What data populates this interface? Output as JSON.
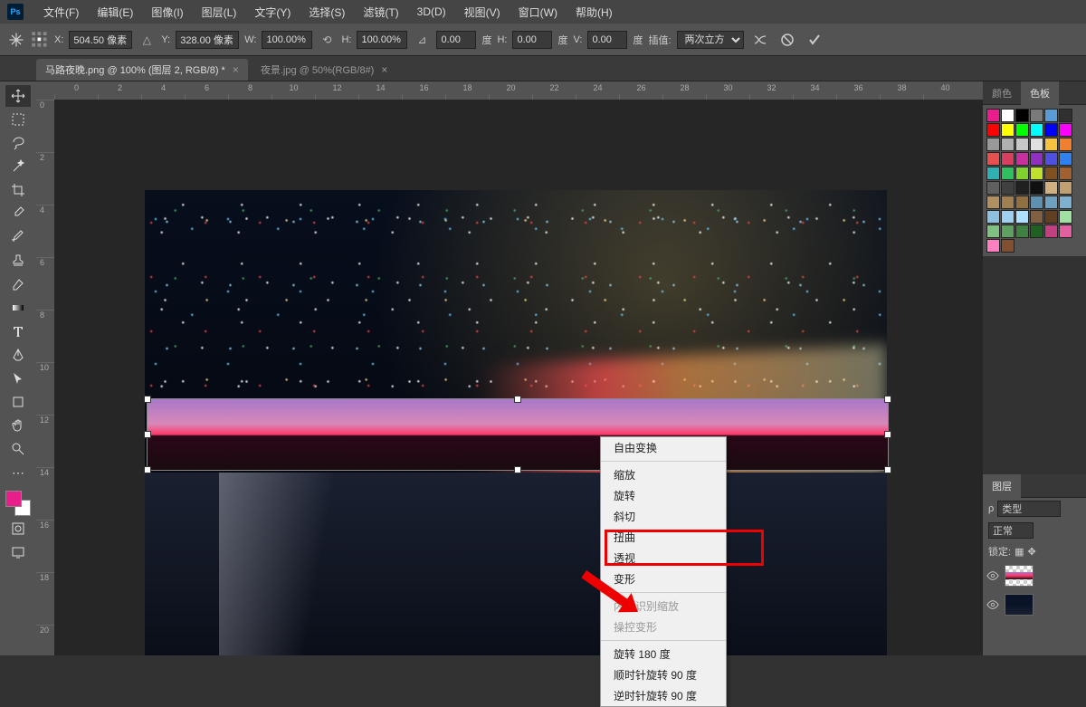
{
  "app": {
    "logo": "Ps"
  },
  "menu": [
    "文件(F)",
    "编辑(E)",
    "图像(I)",
    "图层(L)",
    "文字(Y)",
    "选择(S)",
    "滤镜(T)",
    "3D(D)",
    "视图(V)",
    "窗口(W)",
    "帮助(H)"
  ],
  "options": {
    "x_label": "X:",
    "x": "504.50 像素",
    "y_label": "Y:",
    "y": "328.00 像素",
    "w_label": "W:",
    "w": "100.00%",
    "h_label": "H:",
    "h": "100.00%",
    "angle": "0.00",
    "angle_unit": "度",
    "h2_label": "H:",
    "h2": "0.00",
    "h2_unit": "度",
    "v_label": "V:",
    "v": "0.00",
    "v_unit": "度",
    "interp_label": "插值:",
    "interp": "两次立方"
  },
  "tabs": [
    {
      "title": "马路夜晚.png @ 100% (图层 2, RGB/8) *",
      "active": true
    },
    {
      "title": "夜景.jpg @ 50%(RGB/8#)",
      "active": false
    }
  ],
  "ruler_h": [
    "0",
    "2",
    "4",
    "6",
    "8",
    "10",
    "12",
    "14",
    "16",
    "18",
    "20",
    "22",
    "24",
    "26",
    "28",
    "30",
    "32",
    "34",
    "36",
    "38",
    "40"
  ],
  "ruler_v": [
    "0",
    "2",
    "4",
    "6",
    "8",
    "10",
    "12",
    "14",
    "16",
    "18",
    "20"
  ],
  "context_menu": {
    "items": [
      {
        "label": "自由变换",
        "type": "item"
      },
      {
        "type": "sep"
      },
      {
        "label": "缩放",
        "type": "item"
      },
      {
        "label": "旋转",
        "type": "item"
      },
      {
        "label": "斜切",
        "type": "item"
      },
      {
        "label": "扭曲",
        "type": "item"
      },
      {
        "label": "透视",
        "type": "item"
      },
      {
        "label": "变形",
        "type": "item"
      },
      {
        "type": "sep"
      },
      {
        "label": "内容识别缩放",
        "type": "disabled"
      },
      {
        "label": "操控变形",
        "type": "disabled"
      },
      {
        "type": "sep"
      },
      {
        "label": "旋转 180 度",
        "type": "item"
      },
      {
        "label": "顺时针旋转 90 度",
        "type": "item"
      },
      {
        "label": "逆时针旋转 90 度",
        "type": "item"
      }
    ]
  },
  "panels": {
    "color_tab": "颜色",
    "swatch_tab": "色板",
    "swatches": [
      "#e91e8c",
      "#ffffff",
      "#000000",
      "#7a7a7a",
      "#5a9bd5",
      "#303030",
      "#ff0000",
      "#ffff00",
      "#00ff00",
      "#00ffff",
      "#0000ff",
      "#ff00ff",
      "#999999",
      "#b0b0b0",
      "#c8c8c8",
      "#e0e0e0",
      "#f5c242",
      "#f08030",
      "#e85050",
      "#d84060",
      "#c830a0",
      "#9030c0",
      "#5050e0",
      "#3080f0",
      "#30b0b0",
      "#30c060",
      "#80d030",
      "#c0e030",
      "#805020",
      "#a06030",
      "#606060",
      "#404040",
      "#202020",
      "#101010",
      "#d0b080",
      "#c0a070",
      "#b09060",
      "#a08050",
      "#907040",
      "#6090b0",
      "#70a0c0",
      "#80b0d0",
      "#90c0e0",
      "#a0d0f0",
      "#b0e0ff",
      "#806040",
      "#604020",
      "#a0e0a0",
      "#80c080",
      "#60a060",
      "#408040",
      "#206020",
      "#c04080",
      "#e060a0",
      "#ff80c0",
      "#805030"
    ],
    "layers_tab": "图层",
    "kind_label": "类型",
    "blend": "正常",
    "lock_label": "锁定:"
  }
}
